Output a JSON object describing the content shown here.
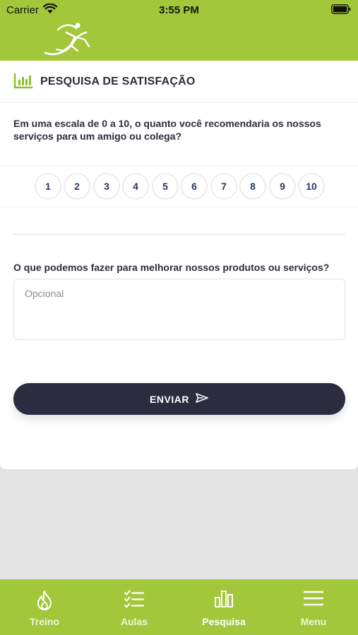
{
  "status_bar": {
    "carrier": "Carrier",
    "time": "3:55 PM"
  },
  "header": {
    "logo": "runner-logo-icon"
  },
  "survey": {
    "title": "PESQUISA DE SATISFAÇÃO",
    "title_icon": "bar-chart-icon",
    "question_nps": "Em uma escala de 0 a 10, o quanto você recomendaria os nossos serviços para um amigo ou colega?",
    "scale": [
      "1",
      "2",
      "3",
      "4",
      "5",
      "6",
      "7",
      "8",
      "9",
      "10"
    ],
    "question_improve": "O que podemos fazer para melhorar nossos produtos ou serviços?",
    "feedback_placeholder": "Opcional",
    "feedback_value": "",
    "submit_label": "ENVIAR"
  },
  "tabs": [
    {
      "label": "Treino",
      "icon": "flame-icon",
      "active": false
    },
    {
      "label": "Aulas",
      "icon": "checklist-icon",
      "active": false
    },
    {
      "label": "Pesquisa",
      "icon": "bar-chart-icon",
      "active": true
    },
    {
      "label": "Menu",
      "icon": "hamburger-icon",
      "active": false
    }
  ],
  "colors": {
    "brand_green": "#a2c73b",
    "dark_button": "#2b2c3f",
    "scale_text": "#2a3668",
    "background": "#e4e4e4"
  }
}
